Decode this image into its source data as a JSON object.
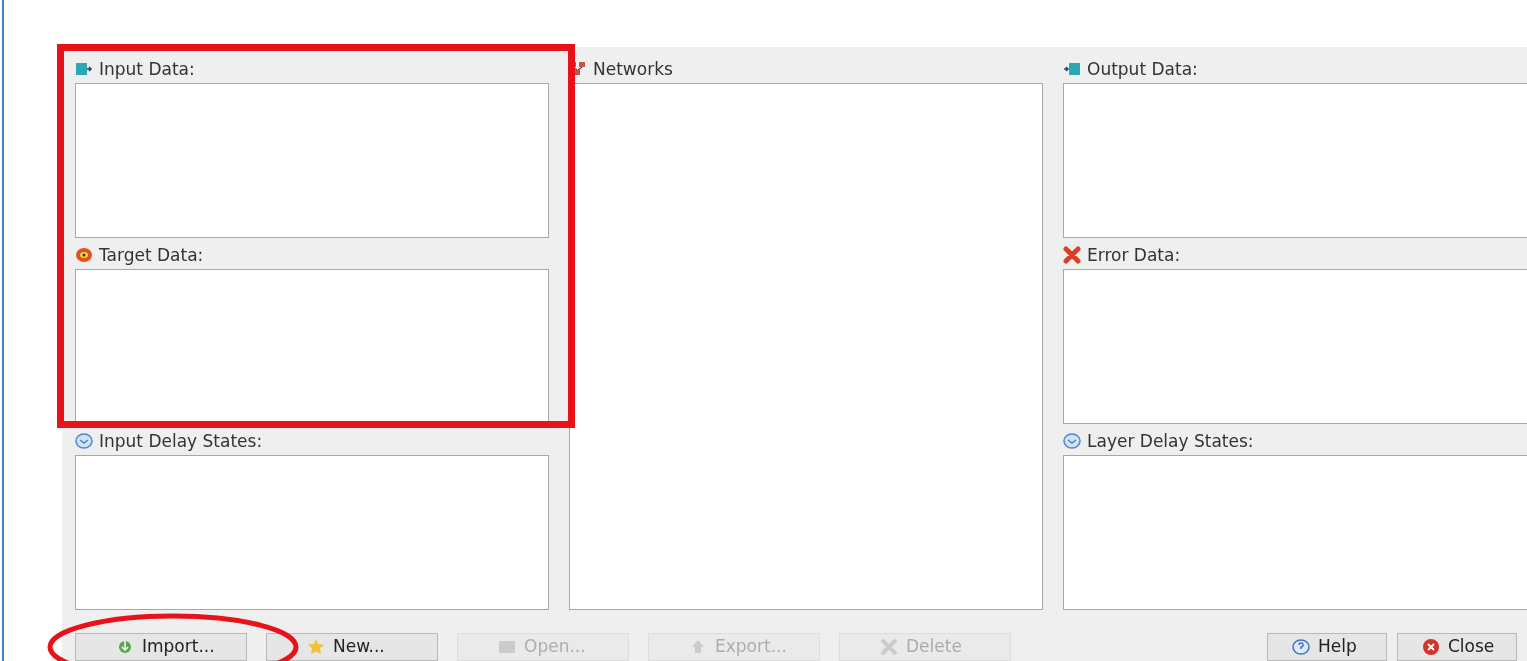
{
  "columns": [
    {
      "panels": [
        {
          "label": "Input Data:",
          "kind": "input"
        },
        {
          "label": "Target Data:",
          "kind": "target"
        },
        {
          "label": "Input Delay States:",
          "kind": "delay"
        }
      ]
    },
    {
      "panels": [
        {
          "label": "Networks",
          "kind": "network"
        }
      ]
    },
    {
      "panels": [
        {
          "label": "Output Data:",
          "kind": "output"
        },
        {
          "label": "Error Data:",
          "kind": "error"
        },
        {
          "label": "Layer Delay States:",
          "kind": "delay"
        }
      ]
    }
  ],
  "buttons_left": [
    {
      "label": "Import...",
      "kind": "import",
      "disabled": false
    },
    {
      "label": "New...",
      "kind": "new",
      "disabled": false
    },
    {
      "label": "Open...",
      "kind": "open",
      "disabled": true
    },
    {
      "label": "Export...",
      "kind": "export",
      "disabled": true
    },
    {
      "label": "Delete",
      "kind": "delete",
      "disabled": true
    }
  ],
  "buttons_right": [
    {
      "label": "Help",
      "kind": "help",
      "disabled": false
    },
    {
      "label": "Close",
      "kind": "close",
      "disabled": false
    }
  ],
  "annotations": [
    {
      "kind": "rectangle"
    },
    {
      "kind": "ellipse"
    }
  ]
}
